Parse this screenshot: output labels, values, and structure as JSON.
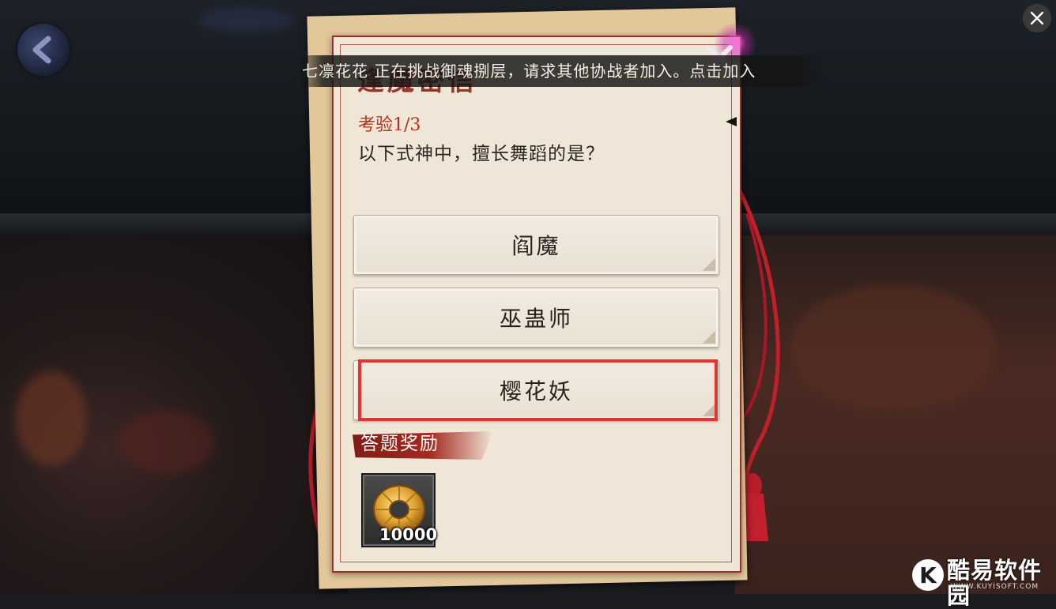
{
  "banner": {
    "message": "七凛花花 正在挑战御魂捌层，请求其他协战者加入。点击加入"
  },
  "card": {
    "title": "逢魔密信",
    "progress": "考验1/3",
    "question": "以下式神中，擅长舞蹈的是？"
  },
  "answers": [
    {
      "label": "阎魔"
    },
    {
      "label": "巫蛊师"
    },
    {
      "label": "樱花妖"
    }
  ],
  "highlighted_answer": "樱花妖",
  "reward": {
    "header": "答题奖励",
    "item_icon": "gold-coin-icon",
    "count": "10000"
  },
  "watermark": {
    "logo_letter": "K",
    "name": "酷易软件园",
    "url": "WWW.KUYISOFT.COM"
  },
  "colors": {
    "accent_red": "#b3321c",
    "highlight_border": "#e8322f",
    "card_bg": "#efe6d7"
  }
}
